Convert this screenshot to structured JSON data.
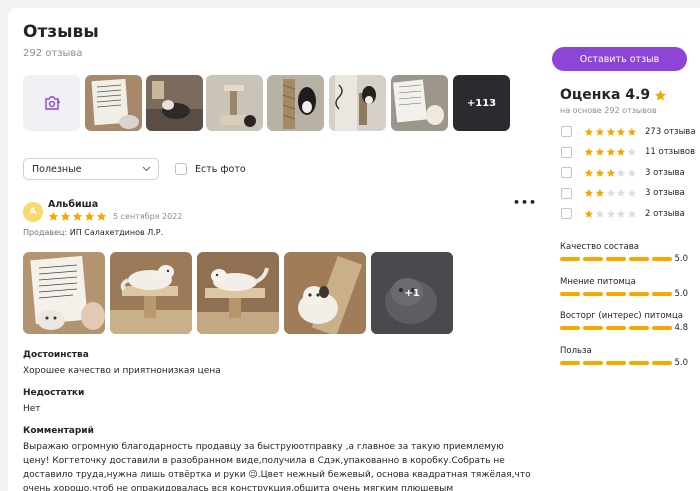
{
  "reviews_header": {
    "title": "Отзывы",
    "count_label": "292 отзыва"
  },
  "photo_strip": {
    "add_photo_icon": "camera-plus-icon",
    "more_label": "+113"
  },
  "controls": {
    "sort_value": "Полезные",
    "photo_filter_label": "Есть фото"
  },
  "review": {
    "avatar_letter": "А",
    "author": "Альбиша",
    "rating": 5,
    "date": "5 сентября 2022",
    "menu_icon": "more-dots-icon",
    "seller_label": "Продавец:",
    "seller_name": "ИП Салахетдинов Л.Р.",
    "photos_more_label": "+1",
    "advantages_title": "Достоинства",
    "advantages_text": "Хорошее качество и приятнонизкая цена",
    "disadvantages_title": "Недостатки",
    "disadvantages_text": "Нет",
    "comment_title": "Комментарий",
    "comment_text": "Выражаю огромную благодарность продавцу за быструюотправку ,а главное за такую приемлемую цену! Когтеточку доставили в разобранном виде,получила в Сдэк,упакованно в коробку.Собрать не доставило труда,нужна лишь отвёртка и руки 😉.Цвет нежный бежевый, основа квадратная тяжёлая,что очень хорошо,чтоб не опракидовалась вся конструкция,обшита очень мягким плюшевым материалом,сама стойка из качественного"
  },
  "sidebar": {
    "leave_review_button": "Оставить отзыв",
    "rating_title": "Оценка 4.9",
    "rating_basis": "на основе 292 отзывов",
    "distribution": [
      {
        "stars": 5,
        "label": "273 отзыва"
      },
      {
        "stars": 4,
        "label": "11 отзывов"
      },
      {
        "stars": 3,
        "label": "3 отзыва"
      },
      {
        "stars": 2,
        "label": "3 отзыва"
      },
      {
        "stars": 1,
        "label": "2 отзыва"
      }
    ],
    "parameters": [
      {
        "label": "Качество состава",
        "value": "5.0"
      },
      {
        "label": "Мнение питомца",
        "value": "5.0"
      },
      {
        "label": "Восторг (интерес) питомца",
        "value": "4.8"
      },
      {
        "label": "Польза",
        "value": "5.0"
      }
    ]
  },
  "colors": {
    "accent_purple": "#8e44d6",
    "star_orange": "#f7a800",
    "star_empty": "#dcdce2",
    "avatar_yellow": "#f8d96a"
  }
}
